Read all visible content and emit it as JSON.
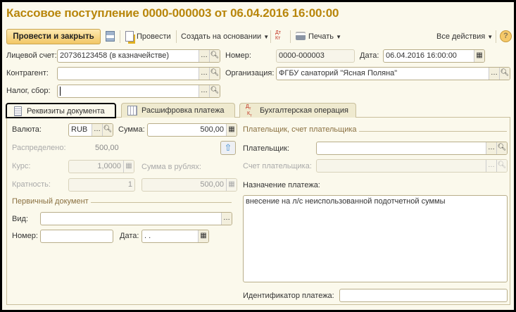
{
  "title": "Кассовое поступление 0000-000003 от 06.04.2016 16:00:00",
  "toolbar": {
    "post_close": "Провести и закрыть",
    "post": "Провести",
    "create_based": "Создать на основании",
    "print": "Печать",
    "all_actions": "Все действия",
    "help": "?",
    "dtkt": "ДтКт"
  },
  "header": {
    "account_label": "Лицевой счет:",
    "account_value": "20736123458 (в казначействе)",
    "number_label": "Номер:",
    "number_value": "0000-000003",
    "date_label": "Дата:",
    "date_value": "06.04.2016 16:00:00",
    "counterparty_label": "Контрагент:",
    "counterparty_value": "",
    "org_label": "Организация:",
    "org_value": "ФГБУ санаторий \"Ясная Поляна\"",
    "tax_label": "Налог, сбор:",
    "tax_value": ""
  },
  "tabs": [
    {
      "label": "Реквизиты документа"
    },
    {
      "label": "Расшифровка платежа"
    },
    {
      "label": "Бухгалтерская операция"
    }
  ],
  "details": {
    "currency_label": "Валюта:",
    "currency_value": "RUB",
    "sum_label": "Сумма:",
    "sum_value": "500,00",
    "distributed_label": "Распределено:",
    "distributed_value": "500,00",
    "rate_label": "Курс:",
    "rate_value": "1,0000",
    "sum_rub_label": "Сумма в рублях:",
    "sum_rub_value": "500,00",
    "multiplicity_label": "Кратность:",
    "multiplicity_value": "1",
    "primary_doc_section": "Первичный документ",
    "kind_label": "Вид:",
    "kind_value": "",
    "doc_number_label": "Номер:",
    "doc_number_value": "",
    "doc_date_label": "Дата:",
    "doc_date_value": " .  .",
    "payer_section": "Плательщик, счет плательщика",
    "payer_label": "Плательщик:",
    "payer_value": "",
    "payer_account_label": "Счет плательщика:",
    "payer_account_value": "",
    "purpose_label": "Назначение платежа:",
    "purpose_value": "внесение на л/с неиспользованной подотчетной суммы",
    "payment_id_label": "Идентификатор платежа:",
    "payment_id_value": ""
  },
  "colors": {
    "title": "#b8860b",
    "background": "#fbf9ec",
    "primary_button": "#f2c766"
  }
}
